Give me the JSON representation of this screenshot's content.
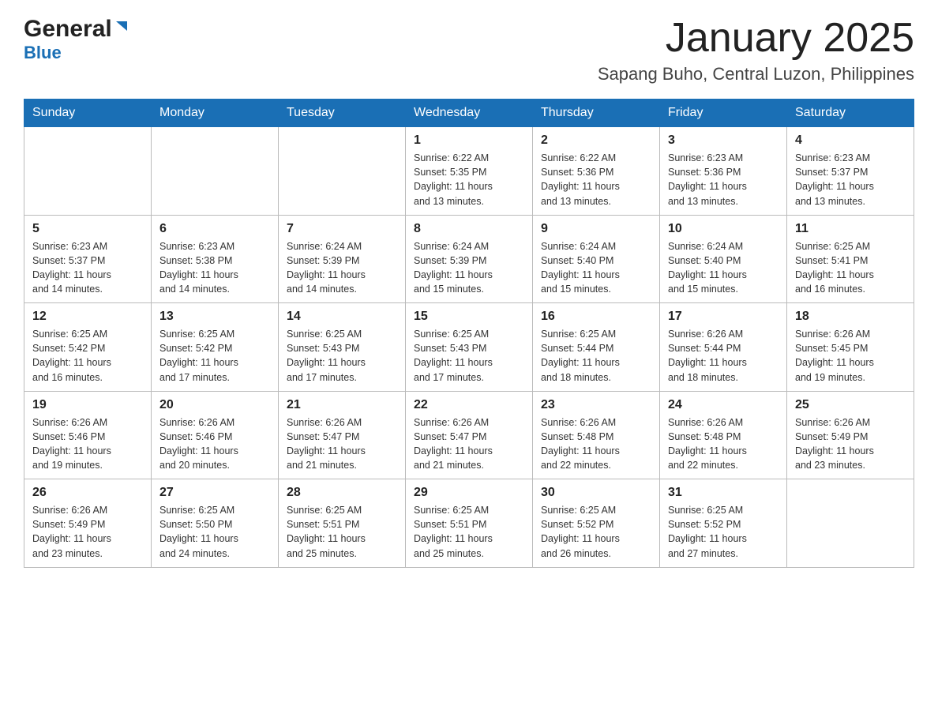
{
  "header": {
    "logo_general": "General",
    "logo_blue": "Blue",
    "month_title": "January 2025",
    "location": "Sapang Buho, Central Luzon, Philippines"
  },
  "days_of_week": [
    "Sunday",
    "Monday",
    "Tuesday",
    "Wednesday",
    "Thursday",
    "Friday",
    "Saturday"
  ],
  "weeks": [
    [
      {
        "day": "",
        "info": ""
      },
      {
        "day": "",
        "info": ""
      },
      {
        "day": "",
        "info": ""
      },
      {
        "day": "1",
        "info": "Sunrise: 6:22 AM\nSunset: 5:35 PM\nDaylight: 11 hours\nand 13 minutes."
      },
      {
        "day": "2",
        "info": "Sunrise: 6:22 AM\nSunset: 5:36 PM\nDaylight: 11 hours\nand 13 minutes."
      },
      {
        "day": "3",
        "info": "Sunrise: 6:23 AM\nSunset: 5:36 PM\nDaylight: 11 hours\nand 13 minutes."
      },
      {
        "day": "4",
        "info": "Sunrise: 6:23 AM\nSunset: 5:37 PM\nDaylight: 11 hours\nand 13 minutes."
      }
    ],
    [
      {
        "day": "5",
        "info": "Sunrise: 6:23 AM\nSunset: 5:37 PM\nDaylight: 11 hours\nand 14 minutes."
      },
      {
        "day": "6",
        "info": "Sunrise: 6:23 AM\nSunset: 5:38 PM\nDaylight: 11 hours\nand 14 minutes."
      },
      {
        "day": "7",
        "info": "Sunrise: 6:24 AM\nSunset: 5:39 PM\nDaylight: 11 hours\nand 14 minutes."
      },
      {
        "day": "8",
        "info": "Sunrise: 6:24 AM\nSunset: 5:39 PM\nDaylight: 11 hours\nand 15 minutes."
      },
      {
        "day": "9",
        "info": "Sunrise: 6:24 AM\nSunset: 5:40 PM\nDaylight: 11 hours\nand 15 minutes."
      },
      {
        "day": "10",
        "info": "Sunrise: 6:24 AM\nSunset: 5:40 PM\nDaylight: 11 hours\nand 15 minutes."
      },
      {
        "day": "11",
        "info": "Sunrise: 6:25 AM\nSunset: 5:41 PM\nDaylight: 11 hours\nand 16 minutes."
      }
    ],
    [
      {
        "day": "12",
        "info": "Sunrise: 6:25 AM\nSunset: 5:42 PM\nDaylight: 11 hours\nand 16 minutes."
      },
      {
        "day": "13",
        "info": "Sunrise: 6:25 AM\nSunset: 5:42 PM\nDaylight: 11 hours\nand 17 minutes."
      },
      {
        "day": "14",
        "info": "Sunrise: 6:25 AM\nSunset: 5:43 PM\nDaylight: 11 hours\nand 17 minutes."
      },
      {
        "day": "15",
        "info": "Sunrise: 6:25 AM\nSunset: 5:43 PM\nDaylight: 11 hours\nand 17 minutes."
      },
      {
        "day": "16",
        "info": "Sunrise: 6:25 AM\nSunset: 5:44 PM\nDaylight: 11 hours\nand 18 minutes."
      },
      {
        "day": "17",
        "info": "Sunrise: 6:26 AM\nSunset: 5:44 PM\nDaylight: 11 hours\nand 18 minutes."
      },
      {
        "day": "18",
        "info": "Sunrise: 6:26 AM\nSunset: 5:45 PM\nDaylight: 11 hours\nand 19 minutes."
      }
    ],
    [
      {
        "day": "19",
        "info": "Sunrise: 6:26 AM\nSunset: 5:46 PM\nDaylight: 11 hours\nand 19 minutes."
      },
      {
        "day": "20",
        "info": "Sunrise: 6:26 AM\nSunset: 5:46 PM\nDaylight: 11 hours\nand 20 minutes."
      },
      {
        "day": "21",
        "info": "Sunrise: 6:26 AM\nSunset: 5:47 PM\nDaylight: 11 hours\nand 21 minutes."
      },
      {
        "day": "22",
        "info": "Sunrise: 6:26 AM\nSunset: 5:47 PM\nDaylight: 11 hours\nand 21 minutes."
      },
      {
        "day": "23",
        "info": "Sunrise: 6:26 AM\nSunset: 5:48 PM\nDaylight: 11 hours\nand 22 minutes."
      },
      {
        "day": "24",
        "info": "Sunrise: 6:26 AM\nSunset: 5:48 PM\nDaylight: 11 hours\nand 22 minutes."
      },
      {
        "day": "25",
        "info": "Sunrise: 6:26 AM\nSunset: 5:49 PM\nDaylight: 11 hours\nand 23 minutes."
      }
    ],
    [
      {
        "day": "26",
        "info": "Sunrise: 6:26 AM\nSunset: 5:49 PM\nDaylight: 11 hours\nand 23 minutes."
      },
      {
        "day": "27",
        "info": "Sunrise: 6:25 AM\nSunset: 5:50 PM\nDaylight: 11 hours\nand 24 minutes."
      },
      {
        "day": "28",
        "info": "Sunrise: 6:25 AM\nSunset: 5:51 PM\nDaylight: 11 hours\nand 25 minutes."
      },
      {
        "day": "29",
        "info": "Sunrise: 6:25 AM\nSunset: 5:51 PM\nDaylight: 11 hours\nand 25 minutes."
      },
      {
        "day": "30",
        "info": "Sunrise: 6:25 AM\nSunset: 5:52 PM\nDaylight: 11 hours\nand 26 minutes."
      },
      {
        "day": "31",
        "info": "Sunrise: 6:25 AM\nSunset: 5:52 PM\nDaylight: 11 hours\nand 27 minutes."
      },
      {
        "day": "",
        "info": ""
      }
    ]
  ]
}
